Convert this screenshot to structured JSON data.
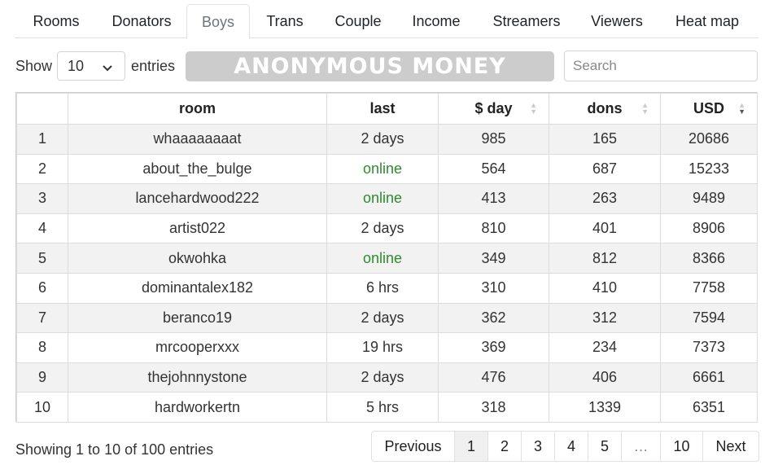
{
  "tabs": [
    {
      "label": "Rooms",
      "active": false
    },
    {
      "label": "Donators",
      "active": false
    },
    {
      "label": "Boys",
      "active": true
    },
    {
      "label": "Trans",
      "active": false
    },
    {
      "label": "Couple",
      "active": false
    },
    {
      "label": "Income",
      "active": false
    },
    {
      "label": "Streamers",
      "active": false
    },
    {
      "label": "Viewers",
      "active": false
    },
    {
      "label": "Heat map",
      "active": false
    }
  ],
  "controls": {
    "show_label": "Show",
    "show_value": "10",
    "entries_label": "entries",
    "banner_text": "ANONYMOUS MONEY",
    "search_placeholder": "Search"
  },
  "table": {
    "columns": [
      "",
      "room",
      "last",
      "$ day",
      "dons",
      "USD"
    ],
    "sorted_column": "USD",
    "sort_direction": "desc",
    "rows": [
      {
        "n": "1",
        "room": "whaaaaaaaat",
        "last": "2 days",
        "online": false,
        "day": "985",
        "dons": "165",
        "usd": "20686"
      },
      {
        "n": "2",
        "room": "about_the_bulge",
        "last": "online",
        "online": true,
        "day": "564",
        "dons": "687",
        "usd": "15233"
      },
      {
        "n": "3",
        "room": "lancehardwood222",
        "last": "online",
        "online": true,
        "day": "413",
        "dons": "263",
        "usd": "9489"
      },
      {
        "n": "4",
        "room": "artist022",
        "last": "2 days",
        "online": false,
        "day": "810",
        "dons": "401",
        "usd": "8906"
      },
      {
        "n": "5",
        "room": "okwohka",
        "last": "online",
        "online": true,
        "day": "349",
        "dons": "812",
        "usd": "8366"
      },
      {
        "n": "6",
        "room": "dominantalex182",
        "last": "6 hrs",
        "online": false,
        "day": "310",
        "dons": "410",
        "usd": "7758"
      },
      {
        "n": "7",
        "room": "beranco19",
        "last": "2 days",
        "online": false,
        "day": "362",
        "dons": "312",
        "usd": "7594"
      },
      {
        "n": "8",
        "room": "mrcooperxxx",
        "last": "19 hrs",
        "online": false,
        "day": "369",
        "dons": "234",
        "usd": "7373"
      },
      {
        "n": "9",
        "room": "thejohnnystone",
        "last": "2 days",
        "online": false,
        "day": "476",
        "dons": "406",
        "usd": "6661"
      },
      {
        "n": "10",
        "room": "hardworkertn",
        "last": "5 hrs",
        "online": false,
        "day": "318",
        "dons": "1339",
        "usd": "6351"
      }
    ]
  },
  "footer": {
    "info": "Showing 1 to 10 of 100 entries",
    "pages": [
      {
        "label": "Previous",
        "active": false,
        "kind": "prev"
      },
      {
        "label": "1",
        "active": true,
        "kind": "page"
      },
      {
        "label": "2",
        "active": false,
        "kind": "page"
      },
      {
        "label": "3",
        "active": false,
        "kind": "page"
      },
      {
        "label": "4",
        "active": false,
        "kind": "page"
      },
      {
        "label": "5",
        "active": false,
        "kind": "page"
      },
      {
        "label": "…",
        "active": false,
        "kind": "dots"
      },
      {
        "label": "10",
        "active": false,
        "kind": "page"
      },
      {
        "label": "Next",
        "active": false,
        "kind": "next"
      }
    ]
  },
  "colors": {
    "online": "#2e8b2e",
    "banner_bg": "#cccccc",
    "stripe": "#f2f2f2"
  }
}
